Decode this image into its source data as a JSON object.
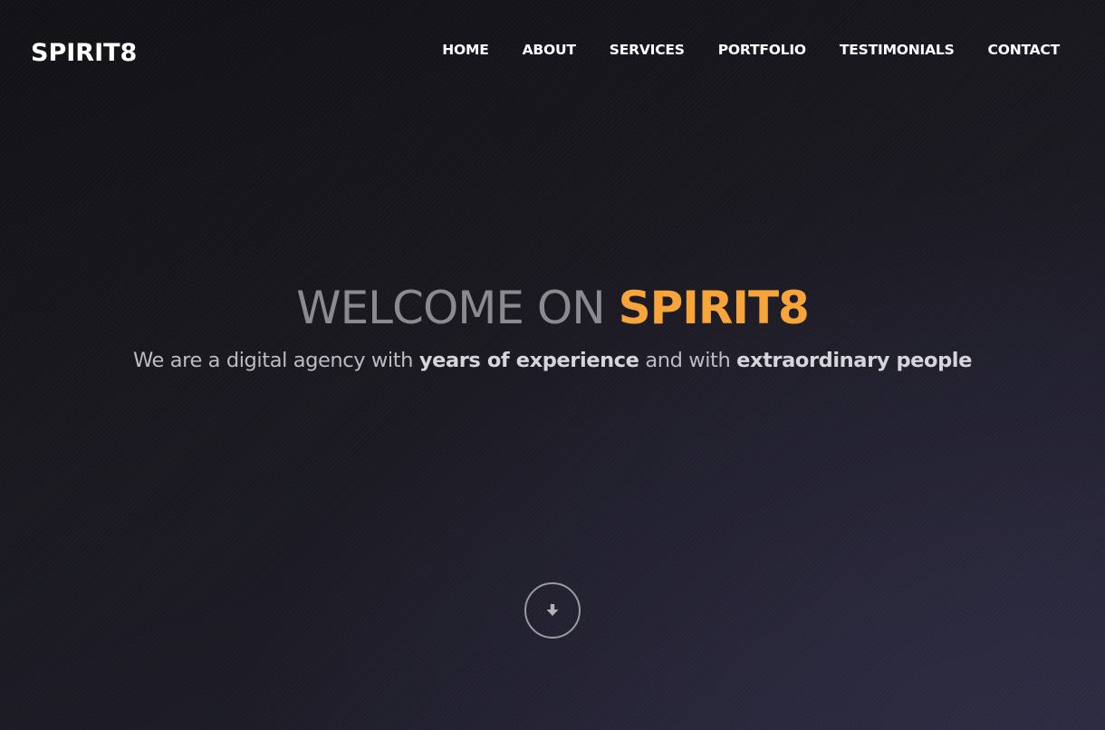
{
  "brand": {
    "name": "SPIRIT8"
  },
  "nav": {
    "items": [
      {
        "label": "HOME"
      },
      {
        "label": "ABOUT"
      },
      {
        "label": "SERVICES"
      },
      {
        "label": "PORTFOLIO"
      },
      {
        "label": "TESTIMONIALS"
      },
      {
        "label": "CONTACT"
      }
    ]
  },
  "hero": {
    "title_prefix": "WELCOME ON ",
    "title_accent": "SPIRIT8",
    "subtitle_part1": "We are a digital agency with ",
    "subtitle_bold1": "years of experience",
    "subtitle_part2": " and with ",
    "subtitle_bold2": "extraordinary people"
  },
  "scroll_button": {
    "icon": "arrow-down-icon"
  },
  "colors": {
    "accent": "#f7a53a",
    "background": "#15141c",
    "title_gray": "#8c8a91",
    "subtitle_gray": "#bdbcc2"
  }
}
